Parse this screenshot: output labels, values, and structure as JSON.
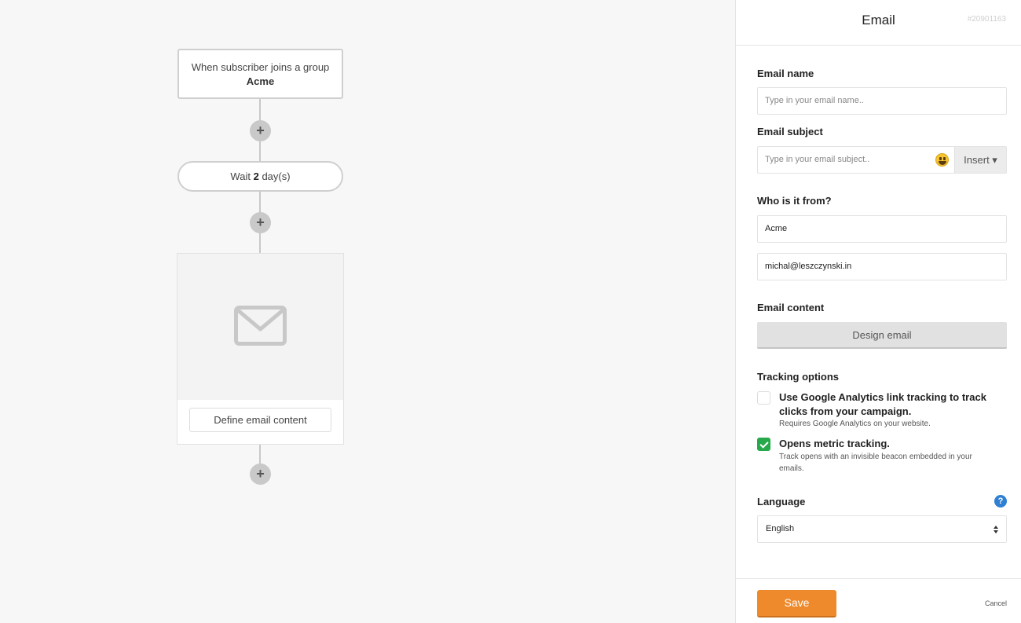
{
  "workflow": {
    "trigger_text": "When subscriber joins a group",
    "trigger_group": "Acme",
    "wait_prefix": "Wait",
    "wait_value": "2",
    "wait_unit": "day(s)",
    "plus_symbol": "+",
    "define_email_label": "Define email content",
    "mail_icon": "envelope-icon"
  },
  "panel": {
    "title": "Email",
    "id": "#20901163",
    "email_name": {
      "label": "Email name",
      "placeholder": "Type in your email name.."
    },
    "email_subject": {
      "label": "Email subject",
      "placeholder": "Type in your email subject..",
      "insert_label": "Insert ▾",
      "emoji_icon": "smiley-icon"
    },
    "from": {
      "label": "Who is it from?",
      "name_value": "Acme",
      "email_value": "michal@leszczynski.in"
    },
    "content": {
      "label": "Email content",
      "design_label": "Design email"
    },
    "tracking": {
      "label": "Tracking options",
      "options": [
        {
          "title": "Use Google Analytics link tracking to track clicks from your campaign.",
          "desc": "Requires Google Analytics on your website.",
          "checked": false
        },
        {
          "title": "Opens metric tracking.",
          "desc": "Track opens with an invisible beacon embedded in your emails.",
          "checked": true
        }
      ]
    },
    "language": {
      "label": "Language",
      "value": "English",
      "help_icon": "?"
    },
    "save_label": "Save",
    "cancel_label": "Cancel"
  },
  "colors": {
    "save": "#ee8a2c",
    "check": "#27a84a",
    "help": "#2f7fd3"
  }
}
